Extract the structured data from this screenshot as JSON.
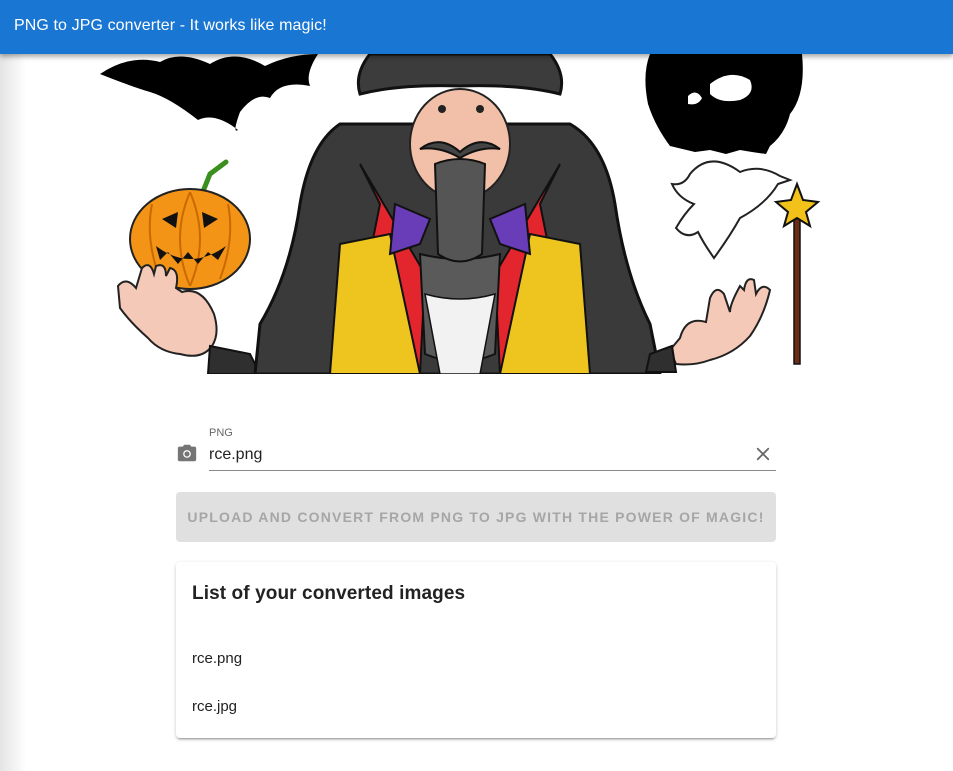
{
  "appbar": {
    "title": "PNG to JPG converter - It works like magic!"
  },
  "hero": {
    "alt": "wizard illustration with pumpkin, skull, dove and magic wand"
  },
  "upload": {
    "label": "PNG",
    "value": "rce.png",
    "button_label": "Upload and convert from PNG to JPG with the power of magic!"
  },
  "converted": {
    "title": "List of your converted images",
    "items": [
      "rce.png",
      "rce.jpg"
    ]
  },
  "colors": {
    "appbar": "#1976d2",
    "button_disabled": "#e0e0e0"
  },
  "icons": {
    "field_prefix": "camera-icon",
    "field_clear": "close-icon"
  }
}
